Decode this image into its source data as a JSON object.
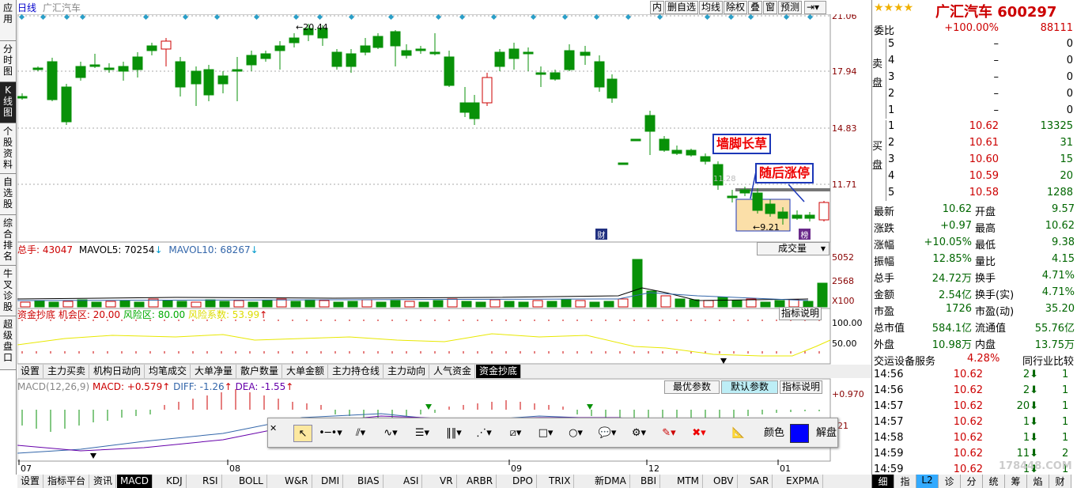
{
  "nav": [
    "应用",
    "分时图",
    "K线图",
    "个股资料",
    "自选股",
    "综合排名",
    "牛叉诊股",
    "超级盘口"
  ],
  "header": {
    "period": "日线",
    "name": "广汇汽车",
    "buttons": [
      "内",
      "删自选",
      "均线",
      "除权",
      "叠",
      "窗",
      "预测"
    ]
  },
  "price_axis": [
    "21.06",
    "17.94",
    "14.83",
    "11.71"
  ],
  "price_marks": {
    "high_label": "20.44",
    "low_label": "9.21",
    "dash_label": "11.28"
  },
  "annotations": {
    "a1": "墙脚长草",
    "a2": "随后涨停",
    "f1": "财",
    "f2": "榜"
  },
  "volume": {
    "total": "总手: 43047",
    "mavol5": "MAVOL5: 70254",
    "mavol10": "MAVOL10: 68267",
    "dropdown": "成交量",
    "axis": [
      "5052",
      "2568"
    ],
    "unit": "X100"
  },
  "indicator1": {
    "title": "资金抄底",
    "opp": "机会区: 20.00",
    "risk": "风险区: 80.00",
    "coef": "风险系数: 53.99",
    "help": "指标说明",
    "axis": [
      "100.00",
      "50.00"
    ]
  },
  "tabs1": [
    "设置",
    "主力买卖",
    "机构日动向",
    "均笔成交",
    "大单净量",
    "散户数量",
    "大单金额",
    "主力持仓线",
    "主力动向",
    "人气资金",
    "资金抄底"
  ],
  "macd": {
    "title": "MACD(12,26,9)",
    "macd": "MACD: +0.579",
    "diff": "DIFF: -1.26",
    "dea": "DEA: -1.55",
    "btn1": "最优参数",
    "btn2": "默认参数",
    "btn3": "指标说明",
    "axis": [
      "+0.970",
      "821"
    ]
  },
  "xaxis": [
    "07",
    "08",
    "09",
    "12",
    "01"
  ],
  "tabs2": [
    "设置",
    "指标平台",
    "资讯",
    "MACD",
    "KDJ",
    "RSI",
    "BOLL",
    "W&R",
    "DMI",
    "BIAS",
    "ASI",
    "VR",
    "ARBR",
    "DPO",
    "TRIX",
    "新DMA",
    "BBI",
    "MTM",
    "OBV",
    "SAR",
    "EXPMA"
  ],
  "draw_toolbar": {
    "color_label": "颜色",
    "unlock_label": "解盘",
    "color": "#0000ff"
  },
  "quote": {
    "stars": "★★★★",
    "title": "广汇汽车 600297",
    "wb_label": "委比",
    "wb_pct": "+100.00%",
    "wb_val": "88111",
    "sell_label": "卖盘",
    "sells": [
      [
        "5",
        "–",
        "0"
      ],
      [
        "4",
        "–",
        "0"
      ],
      [
        "3",
        "–",
        "0"
      ],
      [
        "2",
        "–",
        "0"
      ],
      [
        "1",
        "–",
        "0"
      ]
    ],
    "buy_label": "买盘",
    "buys": [
      [
        "1",
        "10.62",
        "13325"
      ],
      [
        "2",
        "10.61",
        "31"
      ],
      [
        "3",
        "10.60",
        "15"
      ],
      [
        "4",
        "10.59",
        "20"
      ],
      [
        "5",
        "10.58",
        "1288"
      ]
    ],
    "stats": [
      [
        "最新",
        "10.62",
        "开盘",
        "9.57"
      ],
      [
        "涨跌",
        "+0.97",
        "最高",
        "10.62"
      ],
      [
        "涨幅",
        "+10.05%",
        "最低",
        "9.38"
      ],
      [
        "振幅",
        "12.85%",
        "量比",
        "4.15"
      ],
      [
        "总手",
        "24.72万",
        "换手",
        "4.71%"
      ],
      [
        "金额",
        "2.54亿",
        "换手(实)",
        "4.71%"
      ],
      [
        "市盈",
        "1726",
        "市盈(动)",
        "35.20"
      ],
      [
        "总市值",
        "584.1亿",
        "流通值",
        "55.76亿"
      ],
      [
        "外盘",
        "10.98万",
        "内盘",
        "13.75万"
      ]
    ],
    "sector": "交运设备服务",
    "sector_pct": "4.28%",
    "compare": "同行业比较",
    "ticks": [
      [
        "14:56",
        "10.62",
        "2",
        "1"
      ],
      [
        "14:56",
        "10.62",
        "2",
        "1"
      ],
      [
        "14:57",
        "10.62",
        "20",
        "1"
      ],
      [
        "14:57",
        "10.62",
        "1",
        "1"
      ],
      [
        "14:58",
        "10.62",
        "1",
        "1"
      ],
      [
        "14:59",
        "10.62",
        "11",
        "2"
      ],
      [
        "14:59",
        "10.62",
        "1",
        "1"
      ]
    ],
    "bottom_tabs": [
      "细",
      "指",
      "L2",
      "诊",
      "分",
      "统",
      "筹",
      "焰",
      "财"
    ],
    "watermark": "178448.COM"
  }
}
